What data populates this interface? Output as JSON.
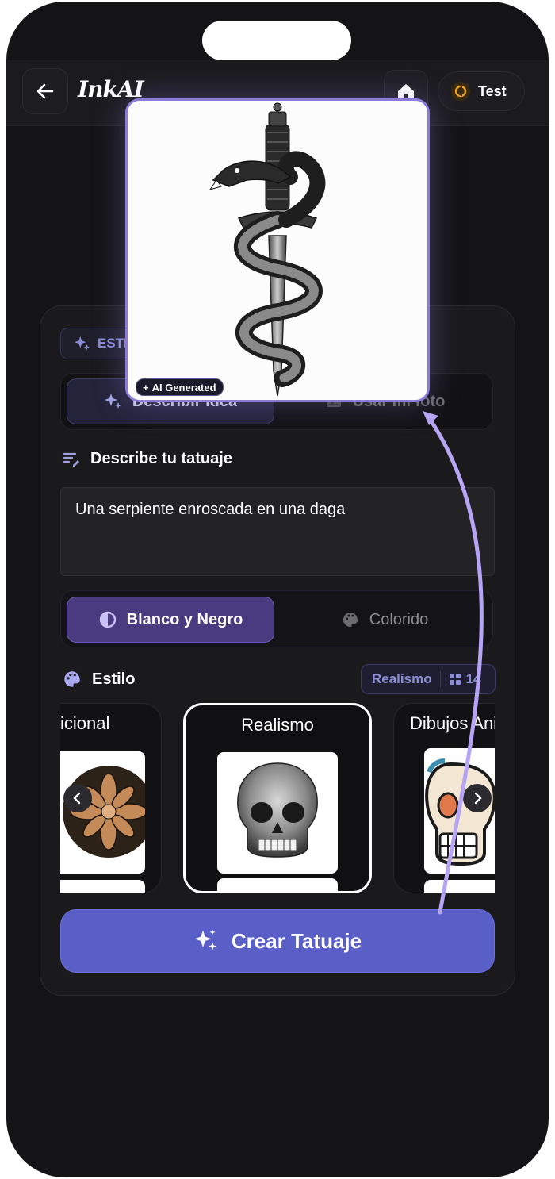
{
  "header": {
    "logo": "InkAI",
    "credits_label": "Test"
  },
  "card": {
    "badge_label": "ESTILO",
    "mode_tabs": [
      {
        "label": "Describir idea",
        "selected": true
      },
      {
        "label": "Usar mi foto",
        "selected": false
      }
    ],
    "describe_title": "Describe tu tatuaje",
    "prompt_value": "Una serpiente enroscada en una daga",
    "color_modes": [
      {
        "label": "Blanco y Negro",
        "selected": true
      },
      {
        "label": "Colorido",
        "selected": false
      }
    ],
    "style_title": "Estilo",
    "style_pill": {
      "selected": "Realismo",
      "count": "14"
    },
    "styles": [
      {
        "label": "Tradicional"
      },
      {
        "label": "Realismo",
        "selected": true
      },
      {
        "label": "Dibujos Animados"
      }
    ],
    "create_label": "Crear Tatuaje"
  },
  "popup": {
    "badge": "AI Generated"
  },
  "colors": {
    "accent": "#5a5fc8",
    "highlight": "#8c7cd8",
    "background": "#141416"
  }
}
